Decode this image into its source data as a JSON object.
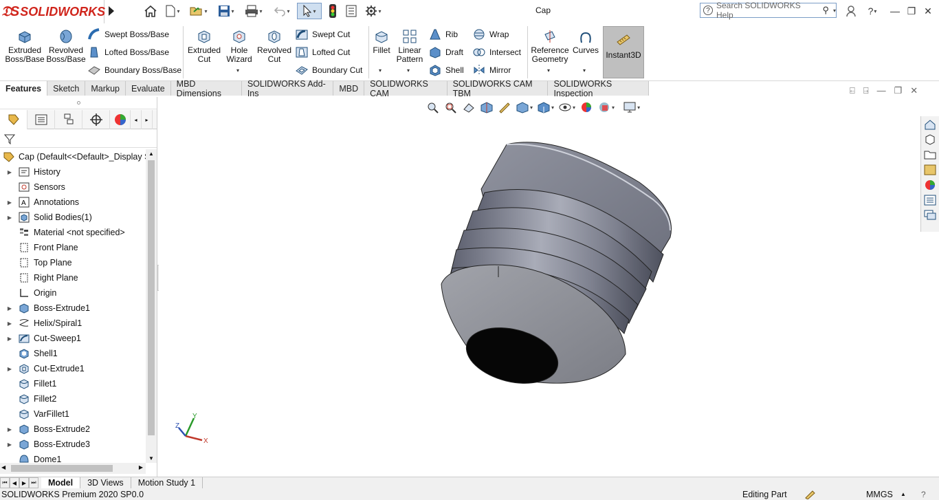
{
  "app": {
    "brand": "SOLIDWORKS",
    "doc_title": "Cap"
  },
  "search": {
    "placeholder": "Search SOLIDWORKS Help"
  },
  "ribbon": {
    "extruded_boss": "Extruded Boss/Base",
    "revolved_boss": "Revolved Boss/Base",
    "swept_boss": "Swept Boss/Base",
    "lofted_boss": "Lofted Boss/Base",
    "boundary_boss": "Boundary Boss/Base",
    "extruded_cut": "Extruded Cut",
    "hole_wizard": "Hole Wizard",
    "revolved_cut": "Revolved Cut",
    "swept_cut": "Swept Cut",
    "lofted_cut": "Lofted Cut",
    "boundary_cut": "Boundary Cut",
    "fillet": "Fillet",
    "linear_pattern": "Linear Pattern",
    "rib": "Rib",
    "draft": "Draft",
    "shell": "Shell",
    "wrap": "Wrap",
    "intersect": "Intersect",
    "mirror": "Mirror",
    "reference_geometry": "Reference Geometry",
    "curves": "Curves",
    "instant3d": "Instant3D"
  },
  "tabs": [
    "Features",
    "Sketch",
    "Markup",
    "Evaluate",
    "MBD Dimensions",
    "SOLIDWORKS Add-Ins",
    "MBD",
    "SOLIDWORKS CAM",
    "SOLIDWORKS CAM TBM",
    "SOLIDWORKS Inspection"
  ],
  "tree": {
    "root": "Cap  (Default<<Default>_Display S",
    "items": [
      {
        "label": "History",
        "expand": true,
        "icon": "history-icon"
      },
      {
        "label": "Sensors",
        "expand": false,
        "icon": "sensors-icon"
      },
      {
        "label": "Annotations",
        "expand": true,
        "icon": "annotations-icon"
      },
      {
        "label": "Solid Bodies(1)",
        "expand": true,
        "icon": "solid-bodies-icon"
      },
      {
        "label": "Material <not specified>",
        "expand": false,
        "icon": "material-icon"
      },
      {
        "label": "Front Plane",
        "expand": false,
        "icon": "plane-icon"
      },
      {
        "label": "Top Plane",
        "expand": false,
        "icon": "plane-icon"
      },
      {
        "label": "Right Plane",
        "expand": false,
        "icon": "plane-icon"
      },
      {
        "label": "Origin",
        "expand": false,
        "icon": "origin-icon"
      },
      {
        "label": "Boss-Extrude1",
        "expand": true,
        "icon": "extrude-icon"
      },
      {
        "label": "Helix/Spiral1",
        "expand": true,
        "icon": "helix-icon"
      },
      {
        "label": "Cut-Sweep1",
        "expand": true,
        "icon": "cut-sweep-icon"
      },
      {
        "label": "Shell1",
        "expand": false,
        "icon": "shell-icon"
      },
      {
        "label": "Cut-Extrude1",
        "expand": true,
        "icon": "cut-extrude-icon"
      },
      {
        "label": "Fillet1",
        "expand": false,
        "icon": "fillet-icon"
      },
      {
        "label": "Fillet2",
        "expand": false,
        "icon": "fillet-icon"
      },
      {
        "label": "VarFillet1",
        "expand": false,
        "icon": "fillet-icon"
      },
      {
        "label": "Boss-Extrude2",
        "expand": true,
        "icon": "extrude-icon"
      },
      {
        "label": "Boss-Extrude3",
        "expand": true,
        "icon": "extrude-icon"
      },
      {
        "label": "Dome1",
        "expand": false,
        "icon": "dome-icon"
      }
    ]
  },
  "triad": {
    "x": "X",
    "y": "Y",
    "z": "Z"
  },
  "bottom_tabs": [
    "Model",
    "3D Views",
    "Motion Study 1"
  ],
  "status": {
    "left": "SOLIDWORKS Premium 2020 SP0.0",
    "mode": "Editing Part",
    "units": "MMGS"
  },
  "colors": {
    "brand_red": "#d0251c",
    "accent_blue": "#1f6fb5",
    "model_gray": "#8a8d98"
  }
}
